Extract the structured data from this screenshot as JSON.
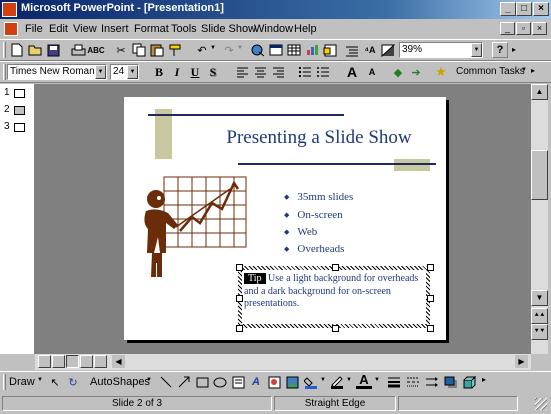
{
  "window": {
    "title": "Microsoft PowerPoint - [Presentation1]",
    "controls": [
      "_",
      "□",
      "×"
    ]
  },
  "menu": [
    "File",
    "Edit",
    "View",
    "Insert",
    "Format",
    "Tools",
    "Slide Show",
    "Window",
    "Help"
  ],
  "standard_toolbar": {
    "zoom": "39%",
    "help_glyph": "?"
  },
  "formatting_toolbar": {
    "font": "Times New Roman",
    "font_size": "24",
    "bold": "B",
    "italic": "I",
    "underline": "U",
    "shadow": "S",
    "grow_font": "A",
    "shrink_font": "A",
    "common_tasks": "Common Tasks"
  },
  "outline": {
    "slides": [
      "1",
      "2",
      "3"
    ]
  },
  "slide": {
    "title": "Presenting a Slide Show",
    "bullets": [
      "35mm slides",
      "On-screen",
      "Web",
      "Overheads"
    ],
    "tip_label": "Tip",
    "tip_text": "Use a light background for overheads and a dark background for on-screen presentations."
  },
  "drawing_toolbar": {
    "draw": "Draw",
    "autoshapes": "AutoShapes"
  },
  "status": {
    "slide": "Slide 2 of 3",
    "design": "Straight Edge"
  },
  "colors": {
    "title_blue": "#1f3a7a",
    "accent_olive": "#c8c8a0",
    "rule_navy": "#1f2a5c",
    "figure_brown": "#6b2c0a"
  }
}
